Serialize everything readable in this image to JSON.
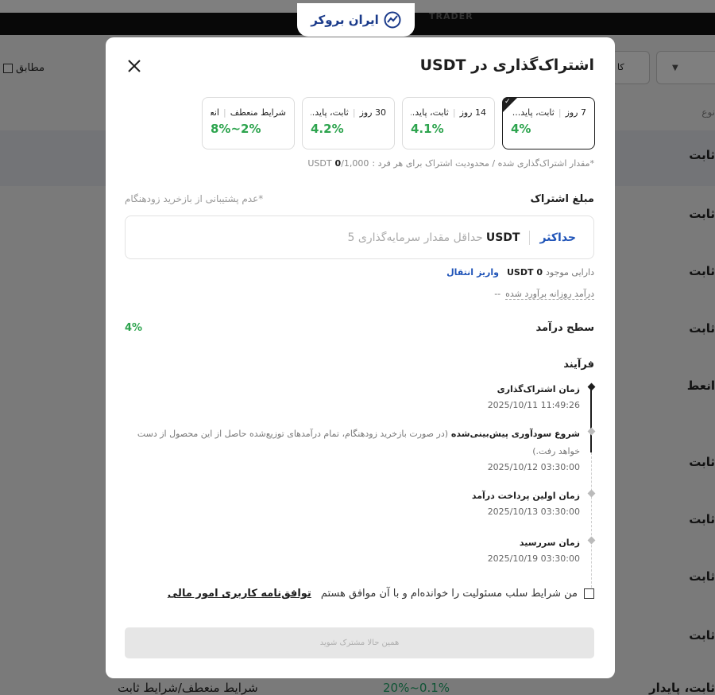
{
  "logo": {
    "text": "ایران بروکر"
  },
  "background": {
    "trader": "TRADER",
    "checkbox_label": "مطابق",
    "select_label": "کا",
    "sub_label": "نوع",
    "row_labels": [
      "ثابت",
      "ثابت",
      "ثابت",
      "ثابت",
      "انعط",
      "ثابت",
      "ثابت",
      "ثابت",
      "ثابت"
    ],
    "bottom_left": "شرایط منعطف/شرایط ثابت",
    "bottom_mid": "20%~0.1%",
    "bottom_right": "ثابت، پایدار"
  },
  "modal": {
    "title": "اشتراک‌گذاری در USDT",
    "plans": [
      {
        "duration": "7 روز",
        "type": "ثابت، پاید...",
        "rate": "4%",
        "selected": true
      },
      {
        "duration": "14 روز",
        "type": "ثابت، پاید...",
        "rate": "4.1%",
        "selected": false
      },
      {
        "duration": "30 روز",
        "type": "ثابت، پاید...",
        "rate": "4.2%",
        "selected": false
      },
      {
        "duration": "شرایط منعطف",
        "type": "انعطاف پذ...",
        "rate": "8%~2%",
        "selected": false
      }
    ],
    "limit": {
      "label": "*مقدار اشتراک‌گذاری شده / محدودیت اشتراک برای هر فرد :",
      "current": "0",
      "max": "/1,000",
      "unit": "USDT"
    },
    "amount": {
      "label": "مبلغ اشتراک",
      "note": "*عدم پشتیبانی از بازخرید زودهنگام",
      "max_label": "حداکثر",
      "unit": "USDT",
      "placeholder": "حداقل مقدار سرمایه‌گذاری 5"
    },
    "balance": {
      "label": "دارایی موجود",
      "value": "0 USDT",
      "deposit": "واریز",
      "transfer": "انتقال"
    },
    "estimated_income": {
      "label": "درآمد روزانه برآورد شده",
      "value": "--"
    },
    "income_level": {
      "label": "سطح درآمد",
      "value": "4%"
    },
    "process": {
      "label": "فرآیند",
      "steps": [
        {
          "title": "زمان اشتراک‌گذاری",
          "note": "",
          "date": "2025/10/11 11:49:26",
          "active": true
        },
        {
          "title": "شروع سودآوری پیش‌بینی‌شده",
          "note": "(در صورت بازخرید زودهنگام، تمام درآمدهای توزیع‌شده حاصل از این محصول از دست خواهد رفت.)",
          "date": "2025/10/12 03:30:00",
          "active": false
        },
        {
          "title": "زمان اولین پرداخت درآمد",
          "note": "",
          "date": "2025/10/13 03:30:00",
          "active": false
        },
        {
          "title": "زمان سررسید",
          "note": "",
          "date": "2025/10/19 03:30:00",
          "active": false
        }
      ]
    },
    "agreement": {
      "text": "من شرایط سلب مسئولیت را خوانده‌ام و با آن موافق هستم",
      "link": "توافق‌نامه کاربری امور مالی"
    },
    "submit_label": "همین حالا مشترک شوید"
  }
}
